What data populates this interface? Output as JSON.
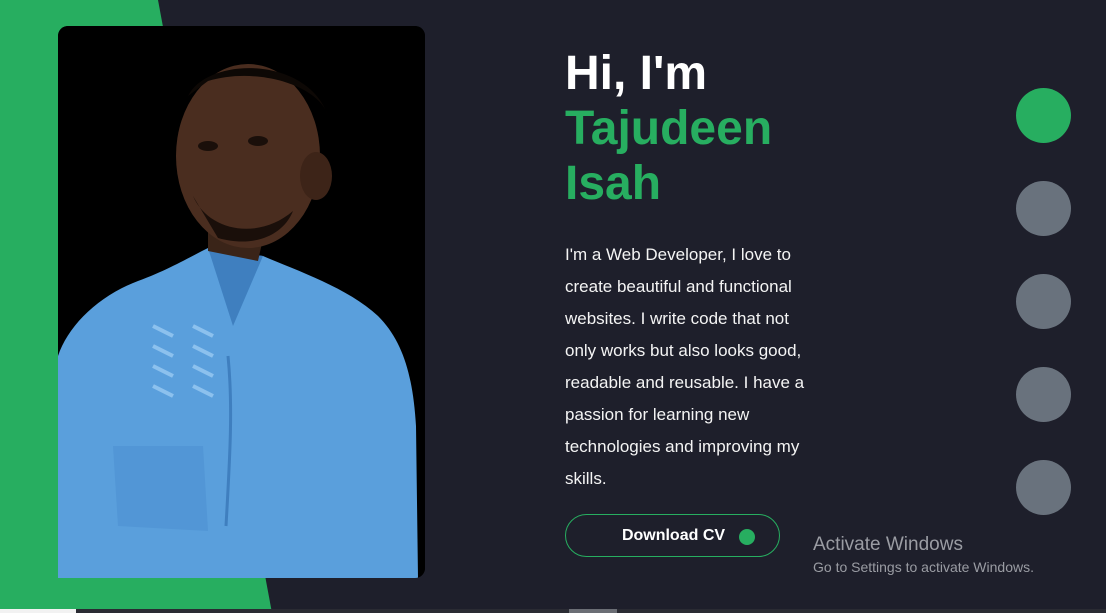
{
  "hero": {
    "greeting": "Hi, I'm",
    "name": "Tajudeen Isah",
    "bio": "I'm a Web Developer, I love to create beautiful and functional websites. I write code that not only works but also looks good, readable and reusable. I have a passion for learning new technologies and improving my skills."
  },
  "download_button": {
    "label": "Download CV"
  },
  "slide_nav": {
    "count": 5,
    "active_index": 0
  },
  "watermark": {
    "title": "Activate Windows",
    "subtitle": "Go to Settings to activate Windows."
  },
  "colors": {
    "background": "#1e1f2b",
    "accent": "#27ae60",
    "inactive_dot": "#69727d",
    "text": "#ffffff"
  }
}
